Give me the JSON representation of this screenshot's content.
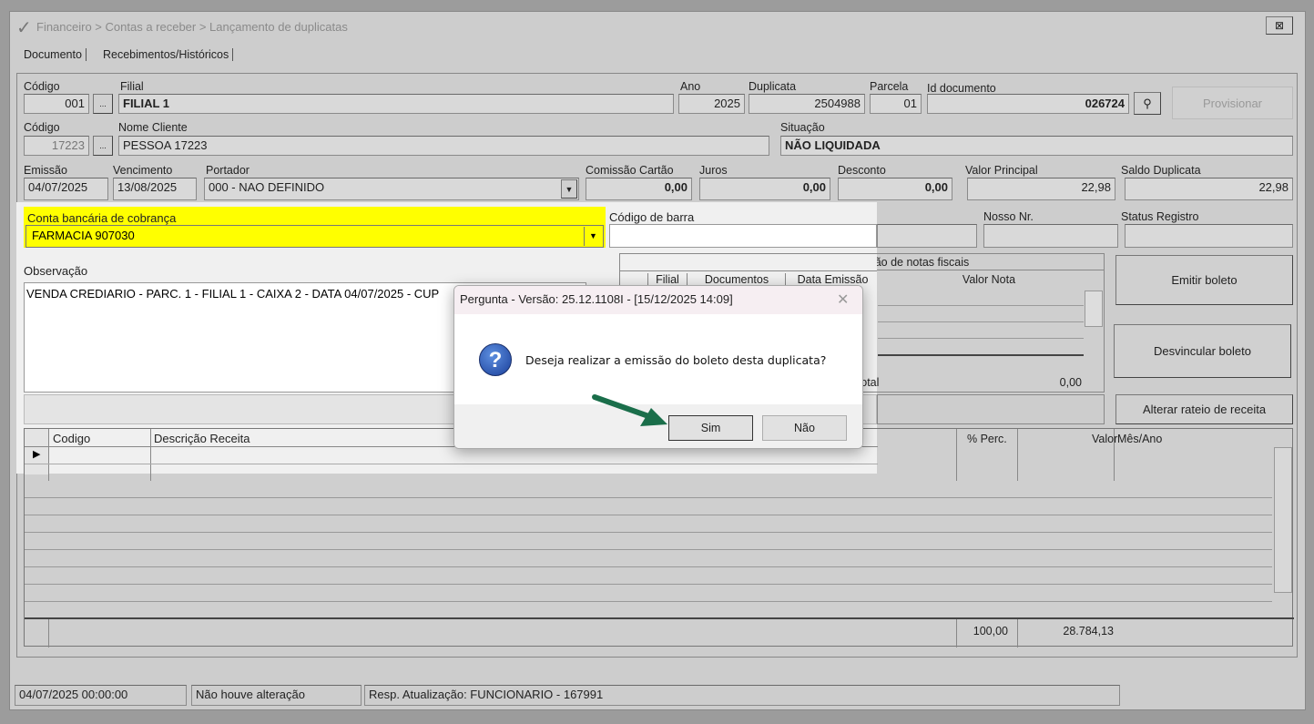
{
  "window": {
    "title": "Financeiro > Contas a receber > Lançamento de duplicatas",
    "close": "⊠"
  },
  "tabs": [
    "Documento",
    "Recebimentos/Históricos"
  ],
  "form": {
    "codigo_label": "Código",
    "codigo": "001",
    "filial_label": "Filial",
    "filial": "FILIAL 1",
    "ano_label": "Ano",
    "ano": "2025",
    "duplicata_label": "Duplicata",
    "duplicata": "2504988",
    "parcela_label": "Parcela",
    "parcela": "01",
    "id_label": "Id documento",
    "id": "026724",
    "provisionar": "Provisionar",
    "browse": "...",
    "cod_cliente_label": "Código",
    "cod_cliente": "17223",
    "nome_label": "Nome Cliente",
    "nome": "PESSOA 17223",
    "situacao_label": "Situação",
    "situacao": "NÃO LIQUIDADA",
    "emissao_label": "Emissão",
    "emissao": "04/07/2025",
    "venc_label": "Vencimento",
    "venc": "13/08/2025",
    "portador_label": "Portador",
    "portador": "000 - NAO DEFINIDO",
    "comissao_label": "Comissão Cartão",
    "comissao": "0,00",
    "juros_label": "Juros",
    "juros": "0,00",
    "desconto_label": "Desconto",
    "desconto": "0,00",
    "principal_label": "Valor Principal",
    "principal": "22,98",
    "saldo_label": "Saldo Duplicata",
    "saldo": "22,98",
    "conta_label": "Conta bancária de cobrança",
    "conta": "FARMACIA 907030",
    "barra_label": "Código de barra",
    "nosso_label": "Nosso Nr.",
    "status_label": "Status Registro",
    "obs_label": "Observação",
    "obs": "VENDA CREDIARIO - PARC. 1 - FILIAL 1 - CAIXA 2 - DATA 04/07/2025 - CUP"
  },
  "notas": {
    "title": "Relação de notas fiscais",
    "cols": [
      "Filial",
      "Documentos",
      "Data Emissão",
      "Valor Nota"
    ],
    "total_label": "Total",
    "total": "0,00"
  },
  "buttons": {
    "emitir": "Emitir boleto",
    "desvincular": "Desvincular boleto",
    "alterar": "Alterar rateio de receita"
  },
  "grid": {
    "cols": [
      "Codigo",
      "Descrição Receita",
      "% Perc.",
      "Valor",
      "Mês/Ano"
    ],
    "total_perc": "100,00",
    "total_valor": "28.784,13"
  },
  "status": [
    "04/07/2025 00:00:00",
    "Não houve alteração",
    "Resp. Atualização: FUNCIONARIO - 167991"
  ],
  "dialog": {
    "title": "Pergunta - Versão: 25.12.1108I - [15/12/2025 14:09]",
    "message": "Deseja realizar a emissão do boleto desta duplicata?",
    "yes": "Sim",
    "no": "Não",
    "close": "✕",
    "icon": "?"
  },
  "colors": {
    "highlight": "#ffff00",
    "arrow": "#1a6e4a"
  }
}
